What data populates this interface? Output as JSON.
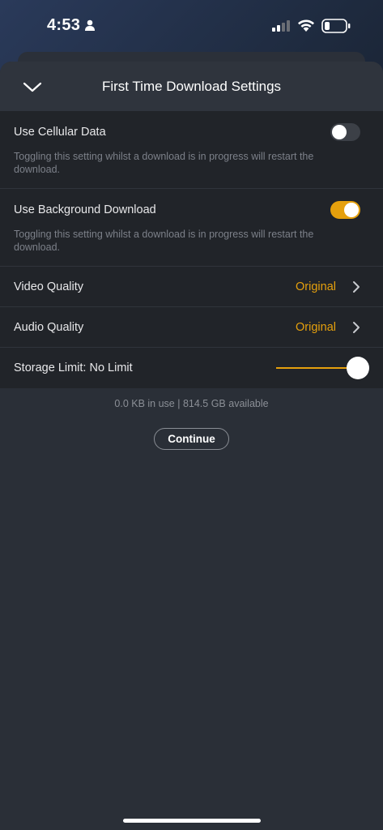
{
  "status_bar": {
    "time": "4:53",
    "icons": [
      "person-icon",
      "cellular-signal-icon",
      "wifi-icon",
      "battery-icon"
    ]
  },
  "sheet": {
    "title": "First Time Download Settings",
    "collapse_icon": "chevron-down-icon"
  },
  "settings": {
    "cellular": {
      "label": "Use Cellular Data",
      "description": "Toggling this setting whilst a download is in progress will restart the download.",
      "enabled": false
    },
    "background": {
      "label": "Use Background Download",
      "description": "Toggling this setting whilst a download is in progress will restart the download.",
      "enabled": true
    },
    "video_quality": {
      "label": "Video Quality",
      "value": "Original"
    },
    "audio_quality": {
      "label": "Audio Quality",
      "value": "Original"
    },
    "storage_limit": {
      "label": "Storage Limit: No Limit",
      "slider_fraction": 1.0
    }
  },
  "storage_info": "0.0 KB in use | 814.5 GB available",
  "continue_label": "Continue",
  "colors": {
    "accent": "#e5a00d",
    "sheet_background": "#2a2f37",
    "rows_background": "#212429"
  }
}
